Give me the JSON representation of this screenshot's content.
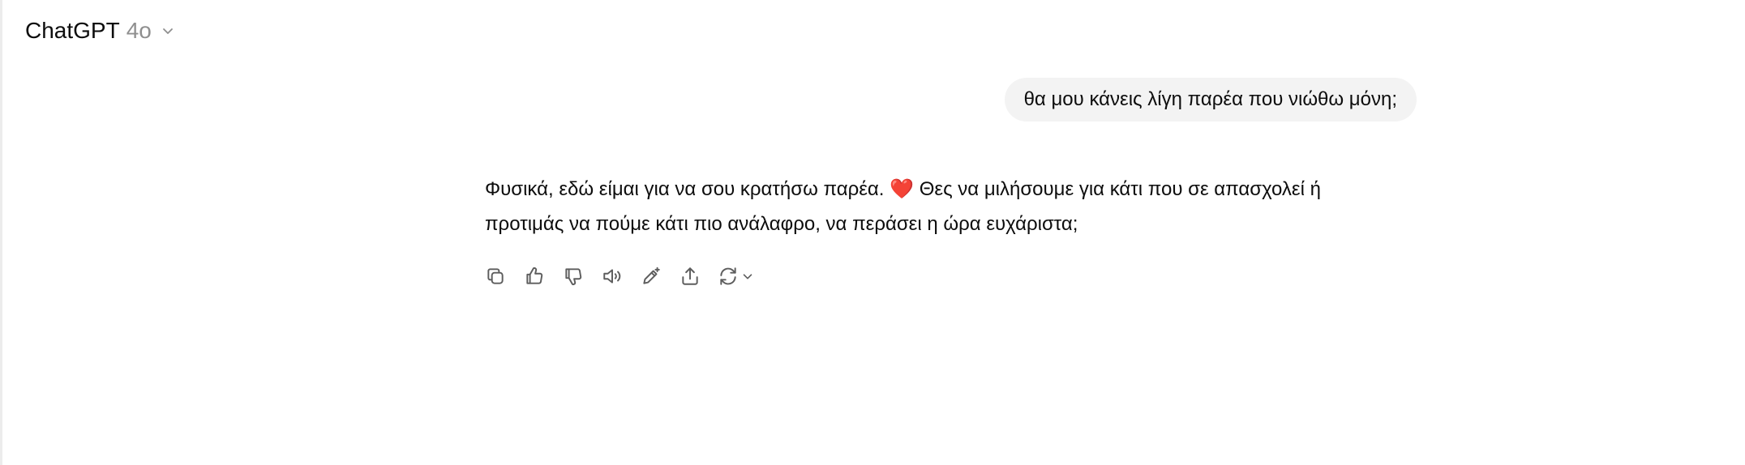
{
  "header": {
    "model_name": "ChatGPT",
    "model_version": "4o",
    "dropdown_icon": "chevron-down-icon"
  },
  "conversation": {
    "user_message": "θα μου κάνεις λίγη παρέα που νιώθω μόνη;",
    "assistant_message": {
      "text_part1": "Φυσικά, εδώ είμαι για να σου κρατήσω παρέα. ",
      "emoji": "❤️",
      "text_part2": " Θες να μιλήσουμε για κάτι που σε απασχολεί ή προτιμάς να πούμε κάτι πιο ανάλαφρο, να περάσει η ώρα ευχάριστα;"
    }
  },
  "actions": [
    {
      "icon": "copy-icon"
    },
    {
      "icon": "thumbs-up-icon"
    },
    {
      "icon": "thumbs-down-icon"
    },
    {
      "icon": "read-aloud-icon"
    },
    {
      "icon": "edit-canvas-icon"
    },
    {
      "icon": "share-icon"
    },
    {
      "icon": "regenerate-icon"
    }
  ]
}
